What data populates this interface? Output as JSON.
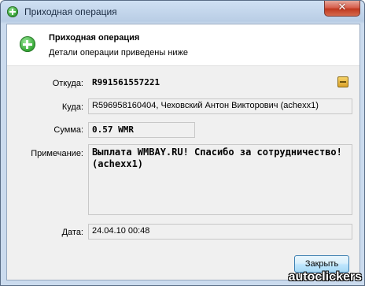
{
  "window": {
    "title": "Приходная операция",
    "close_label": "✕"
  },
  "header": {
    "title": "Приходная операция",
    "subtitle": "Детали операции приведены ниже"
  },
  "fields": {
    "from": {
      "label": "Откуда:",
      "value": "R991561557221"
    },
    "to": {
      "label": "Куда:",
      "value": "R596958160404, Чеховский Антон Викторович (achexx1)"
    },
    "amount": {
      "label": "Сумма:",
      "value": "0.57 WMR"
    },
    "note": {
      "label": "Примечание:",
      "value": "Выплата WMBAY.RU! Спасибо за сотрудничество! (achexx1)"
    },
    "date": {
      "label": "Дата:",
      "value": "24.04.10 00:48"
    }
  },
  "buttons": {
    "close": "Закрыть"
  },
  "watermark": "autoclickers"
}
